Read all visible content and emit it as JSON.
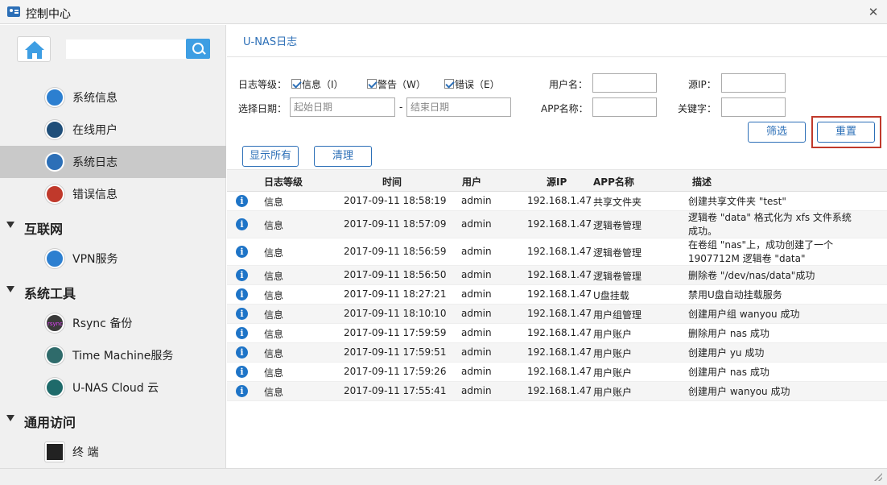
{
  "window": {
    "title": "控制中心",
    "close": "✕"
  },
  "sidebar": {
    "items": [
      {
        "label": "系统信息",
        "color": "#2c7fd0"
      },
      {
        "label": "在线用户",
        "color": "#1f4e79"
      },
      {
        "label": "系统日志",
        "color": "#2c6fb7"
      },
      {
        "label": "错误信息",
        "color": "#c0392b"
      }
    ],
    "groups": [
      {
        "label": "互联网",
        "items": [
          {
            "label": "VPN服务",
            "color": "#2c7fd0"
          }
        ]
      },
      {
        "label": "系统工具",
        "items": [
          {
            "label": "Rsync 备份",
            "color": "#3a3a3a",
            "badge": "rsync"
          },
          {
            "label": "Time Machine服务",
            "color": "#2f6b6b"
          },
          {
            "label": "U-NAS Cloud 云",
            "color": "#1e6a6a"
          }
        ]
      },
      {
        "label": "通用访问",
        "items": [
          {
            "label": "终 端",
            "color": "#222"
          }
        ]
      }
    ]
  },
  "main": {
    "title": "U-NAS日志",
    "filter": {
      "level_label": "日志等级：",
      "levels": [
        "信息（I）",
        "警告（W）",
        "错误（E）"
      ],
      "date_label": "选择日期：",
      "start_placeholder": "起始日期",
      "dash": "-",
      "end_placeholder": "结束日期",
      "user_label": "用户名：",
      "ip_label": "源IP：",
      "app_label": "APP名称：",
      "keyword_label": "关键字："
    },
    "buttons": {
      "filter": "筛选",
      "reset": "重置",
      "show_all": "显示所有",
      "clear": "清理"
    },
    "table": {
      "headers": [
        "日志等级",
        "时间",
        "用户",
        "源IP",
        "APP名称",
        "描述"
      ],
      "rows": [
        {
          "level": "信息",
          "time": "2017-09-11 18:58:19",
          "user": "admin",
          "ip": "192.168.1.47",
          "app": "共享文件夹",
          "desc": "创建共享文件夹 \"test\""
        },
        {
          "level": "信息",
          "time": "2017-09-11 18:57:09",
          "user": "admin",
          "ip": "192.168.1.47",
          "app": "逻辑卷管理",
          "desc": "逻辑卷 \"data\" 格式化为 xfs 文件系统成功。"
        },
        {
          "level": "信息",
          "time": "2017-09-11 18:56:59",
          "user": "admin",
          "ip": "192.168.1.47",
          "app": "逻辑卷管理",
          "desc": "在卷组 \"nas\"上，成功创建了一个 1907712M 逻辑卷 \"data\""
        },
        {
          "level": "信息",
          "time": "2017-09-11 18:56:50",
          "user": "admin",
          "ip": "192.168.1.47",
          "app": "逻辑卷管理",
          "desc": "删除卷 \"/dev/nas/data\"成功"
        },
        {
          "level": "信息",
          "time": "2017-09-11 18:27:21",
          "user": "admin",
          "ip": "192.168.1.47",
          "app": "U盘挂载",
          "desc": "禁用U盘自动挂载服务"
        },
        {
          "level": "信息",
          "time": "2017-09-11 18:10:10",
          "user": "admin",
          "ip": "192.168.1.47",
          "app": "用户组管理",
          "desc": "创建用户组 wanyou 成功"
        },
        {
          "level": "信息",
          "time": "2017-09-11 17:59:59",
          "user": "admin",
          "ip": "192.168.1.47",
          "app": "用户账户",
          "desc": "删除用户 nas 成功"
        },
        {
          "level": "信息",
          "time": "2017-09-11 17:59:51",
          "user": "admin",
          "ip": "192.168.1.47",
          "app": "用户账户",
          "desc": "创建用户 yu 成功"
        },
        {
          "level": "信息",
          "time": "2017-09-11 17:59:26",
          "user": "admin",
          "ip": "192.168.1.47",
          "app": "用户账户",
          "desc": "创建用户 nas 成功"
        },
        {
          "level": "信息",
          "time": "2017-09-11 17:55:41",
          "user": "admin",
          "ip": "192.168.1.47",
          "app": "用户账户",
          "desc": "创建用户 wanyou 成功"
        }
      ]
    }
  }
}
